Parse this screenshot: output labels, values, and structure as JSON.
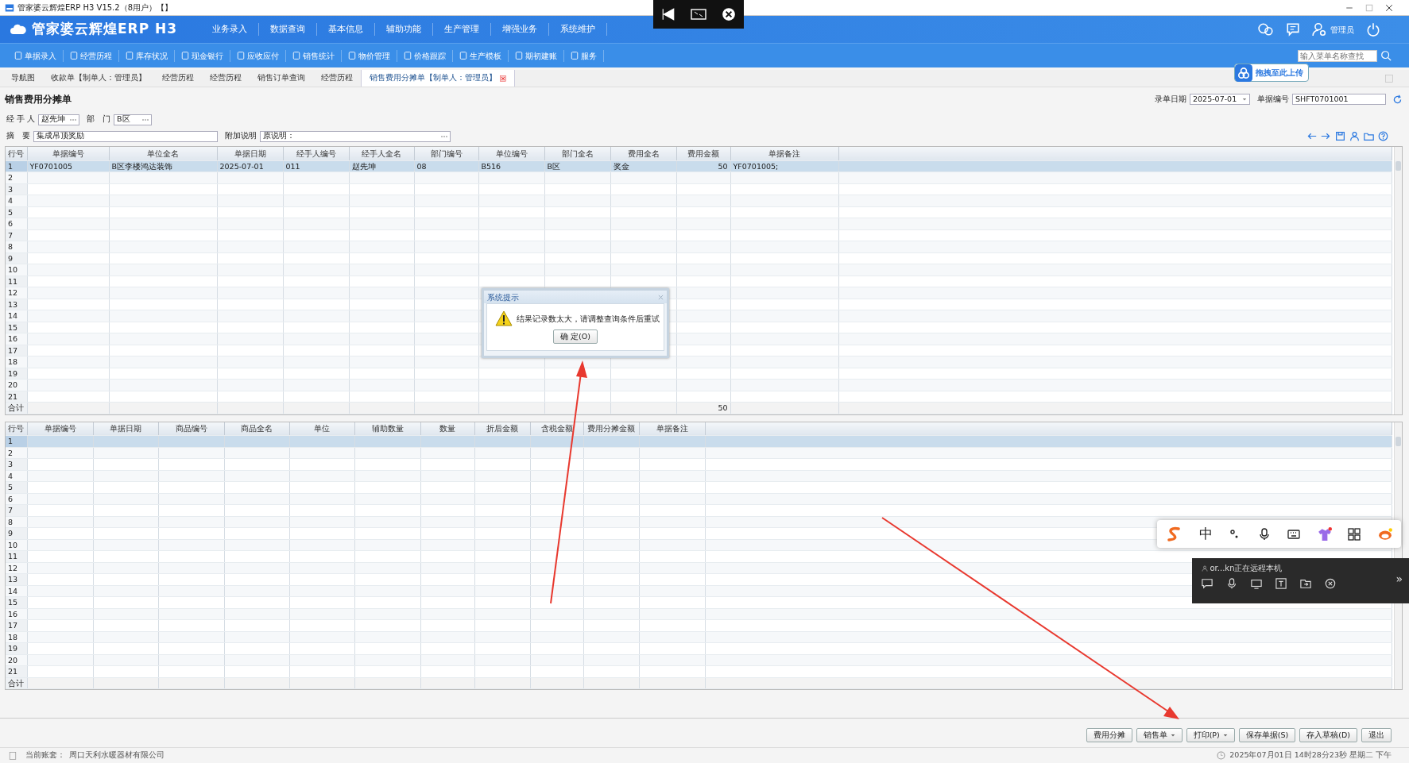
{
  "window": {
    "title": "管家婆云辉煌ERP H3 V15.2（8用户）【】"
  },
  "app": {
    "logo": "管家婆云辉煌ERP H3",
    "user": "管理员"
  },
  "menu": [
    "业务录入",
    "数据查询",
    "基本信息",
    "辅助功能",
    "生产管理",
    "增强业务",
    "系统维护"
  ],
  "toolbar": [
    "单据录入",
    "经营历程",
    "库存状况",
    "现金银行",
    "应收应付",
    "销售统计",
    "物价管理",
    "价格跟踪",
    "生产模板",
    "期初建账",
    "服务"
  ],
  "menu_search": {
    "placeholder": "输入菜单名称查找"
  },
  "upload_button": "拖拽至此上传",
  "tabs": [
    {
      "label": "导航图",
      "selected": false,
      "closable": false
    },
    {
      "label": "收款单【制单人：管理员】",
      "selected": false,
      "closable": false
    },
    {
      "label": "经营历程",
      "selected": false,
      "closable": false
    },
    {
      "label": "经营历程",
      "selected": false,
      "closable": false
    },
    {
      "label": "销售订单查询",
      "selected": false,
      "closable": false
    },
    {
      "label": "经营历程",
      "selected": false,
      "closable": false
    },
    {
      "label": "销售费用分摊单【制单人：管理员】",
      "selected": true,
      "closable": true
    }
  ],
  "form": {
    "title": "销售费用分摊单",
    "handler_label": "经 手 人",
    "handler": "赵先坤",
    "dept_label": "部　门",
    "dept": "B区",
    "summary_label": "摘　要",
    "summary": "集成吊顶奖励",
    "note_label": "附加说明",
    "note": "原说明：",
    "date_label": "录单日期",
    "date": "2025-07-01",
    "doc_no_label": "单据编号",
    "doc_no": "SHFT0701001"
  },
  "upper_table": {
    "row_header": "行号",
    "total_label": "合计",
    "columns": [
      {
        "label": "单据编号"
      },
      {
        "label": "单位全名"
      },
      {
        "label": "单据日期"
      },
      {
        "label": "经手人编号"
      },
      {
        "label": "经手人全名"
      },
      {
        "label": "部门编号"
      },
      {
        "label": "单位编号"
      },
      {
        "label": "部门全名"
      },
      {
        "label": "费用全名"
      },
      {
        "label": "费用金额",
        "total": "50"
      },
      {
        "label": "单据备注"
      }
    ],
    "rows": [
      {
        "no": "1",
        "selected": true,
        "cells": [
          "YF0701005",
          "B区李楼鸿达装饰",
          "2025-07-01",
          "011",
          "赵先坤",
          "08",
          "B516",
          "B区",
          "奖金",
          "50",
          "YF0701005;"
        ]
      },
      {
        "no": "2",
        "selected": false
      },
      {
        "no": "3",
        "selected": false
      },
      {
        "no": "4",
        "selected": false
      },
      {
        "no": "5",
        "selected": false
      },
      {
        "no": "6",
        "selected": false
      },
      {
        "no": "7",
        "selected": false
      },
      {
        "no": "8",
        "selected": false
      },
      {
        "no": "9",
        "selected": false
      },
      {
        "no": "10",
        "selected": false
      },
      {
        "no": "11",
        "selected": false
      },
      {
        "no": "12",
        "selected": false
      },
      {
        "no": "13",
        "selected": false
      },
      {
        "no": "14",
        "selected": false
      },
      {
        "no": "15",
        "selected": false
      },
      {
        "no": "16",
        "selected": false
      },
      {
        "no": "17",
        "selected": false
      },
      {
        "no": "18",
        "selected": false
      },
      {
        "no": "19",
        "selected": false
      },
      {
        "no": "20",
        "selected": false
      },
      {
        "no": "21",
        "selected": false
      }
    ]
  },
  "lower_table": {
    "row_header": "行号",
    "total_label": "合计",
    "columns": [
      {
        "label": "单据编号"
      },
      {
        "label": "单据日期"
      },
      {
        "label": "商品编号"
      },
      {
        "label": "商品全名"
      },
      {
        "label": "单位"
      },
      {
        "label": "辅助数量"
      },
      {
        "label": "数量"
      },
      {
        "label": "折后金额"
      },
      {
        "label": "含税金额"
      },
      {
        "label": "费用分摊金额"
      },
      {
        "label": "单据备注"
      }
    ],
    "rows": [
      {
        "no": "1",
        "selected": true
      },
      {
        "no": "2",
        "selected": false
      },
      {
        "no": "3",
        "selected": false
      },
      {
        "no": "4",
        "selected": false
      },
      {
        "no": "5",
        "selected": false
      },
      {
        "no": "6",
        "selected": false
      },
      {
        "no": "7",
        "selected": false
      },
      {
        "no": "8",
        "selected": false
      },
      {
        "no": "9",
        "selected": false
      },
      {
        "no": "10",
        "selected": false
      },
      {
        "no": "11",
        "selected": false
      },
      {
        "no": "12",
        "selected": false
      },
      {
        "no": "13",
        "selected": false
      },
      {
        "no": "14",
        "selected": false
      },
      {
        "no": "15",
        "selected": false
      },
      {
        "no": "16",
        "selected": false
      },
      {
        "no": "17",
        "selected": false
      },
      {
        "no": "18",
        "selected": false
      },
      {
        "no": "19",
        "selected": false
      },
      {
        "no": "20",
        "selected": false
      },
      {
        "no": "21",
        "selected": false
      }
    ]
  },
  "dialog": {
    "title": "系统提示",
    "message": "结果记录数太大，请调整查询条件后重试",
    "button": "确 定(O)"
  },
  "bottom_buttons": [
    {
      "label": "费用分摊",
      "dropdown": false
    },
    {
      "label": "销售单",
      "dropdown": true
    },
    {
      "label": "打印(P)",
      "dropdown": true
    },
    {
      "label": "保存单据(S)",
      "dropdown": false
    },
    {
      "label": "存入草稿(D)",
      "dropdown": false
    },
    {
      "label": "退出",
      "dropdown": false
    }
  ],
  "status_bar": {
    "account_label": "当前账套：",
    "account": "周口天利水暖器材有限公司",
    "datetime": "2025年07月01日 14时28分23秒 星期二 下午"
  },
  "ime_toolbar": {
    "mode": "中"
  },
  "remote_panel": {
    "text": "or...kn正在远程本机",
    "expand": "»"
  }
}
